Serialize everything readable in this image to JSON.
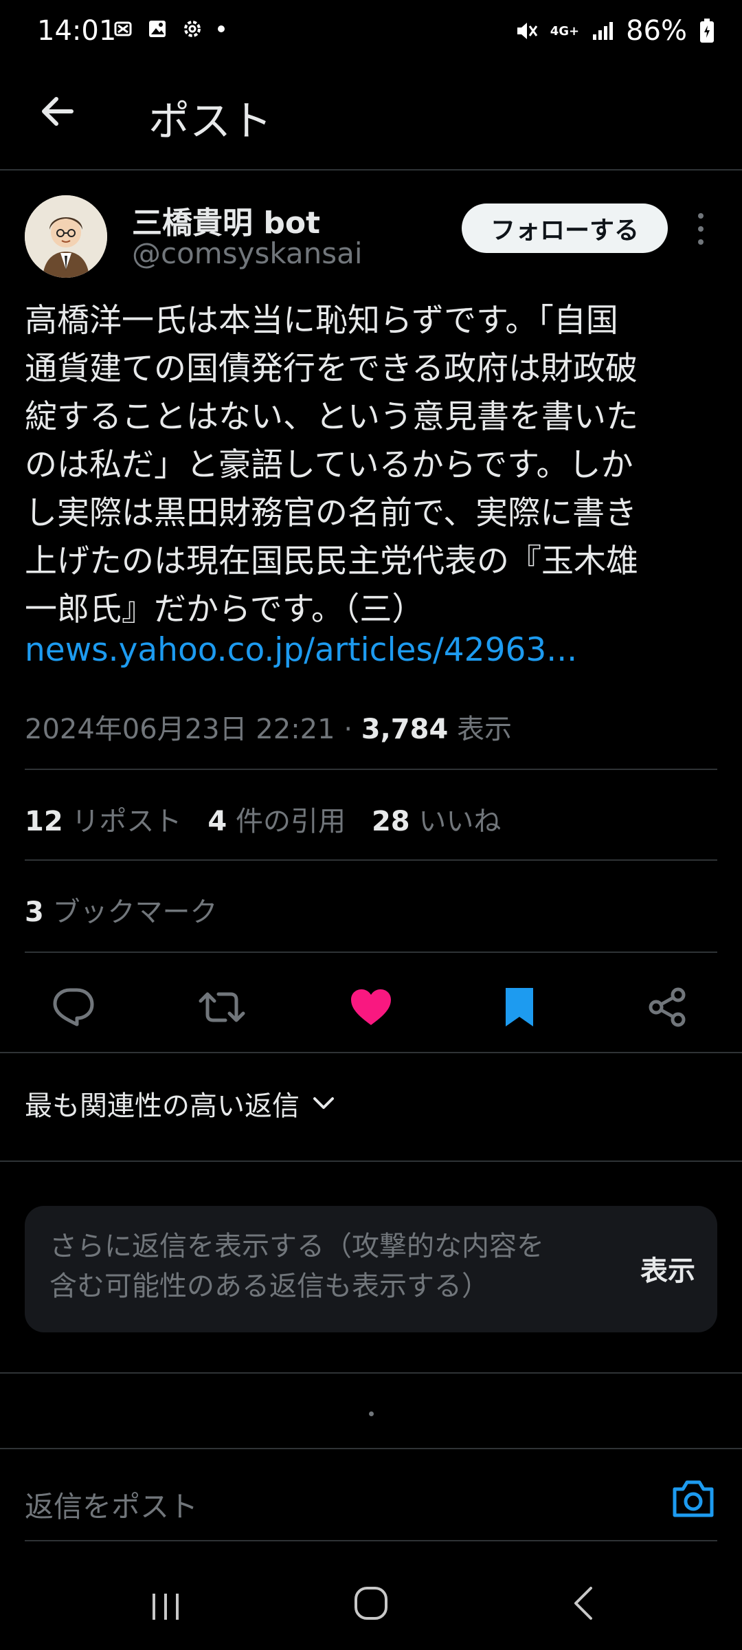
{
  "status_bar": {
    "time": "14:01",
    "network": "4G+",
    "battery": "86%"
  },
  "header": {
    "title": "ポスト"
  },
  "author": {
    "name": "三橋貴明 bot",
    "handle": "@comsyskansai",
    "follow_label": "フォローする"
  },
  "post": {
    "text": "高橋洋一氏は本当に恥知らずです。「自国\n通貨建ての国債発行をできる政府は財政破\n綻することはない、という意見書を書いた\nのは私だ」と豪語しているからです。しか\nし実際は黒田財務官の名前で、実際に書き\n上げたのは現在国民民主党代表の『玉木雄\n一郎氏』だからです。（三）",
    "link": "news.yahoo.co.jp/articles/42963...",
    "datetime": "2024年06月23日 22:21",
    "separator": "·",
    "views_count": "3,784",
    "views_label": "表示"
  },
  "stats": {
    "reposts_count": "12",
    "reposts_label": "リポスト",
    "quotes_count": "4",
    "quotes_label": "件の引用",
    "likes_count": "28",
    "likes_label": "いいね",
    "bookmarks_count": "3",
    "bookmarks_label": "ブックマーク"
  },
  "actions": {
    "icons": [
      "reply-icon",
      "repost-icon",
      "like-icon",
      "bookmark-icon",
      "share-icon"
    ],
    "like_color": "#f91880",
    "bookmark_color": "#1d9bf0"
  },
  "replies": {
    "sort_label": "最も関連性の高い返信",
    "more_text": "さらに返信を表示する（攻撃的な内容を\n含む可能性のある返信も表示する）",
    "show_label": "表示"
  },
  "compose": {
    "placeholder": "返信をポスト",
    "accent": "#1d9bf0"
  }
}
